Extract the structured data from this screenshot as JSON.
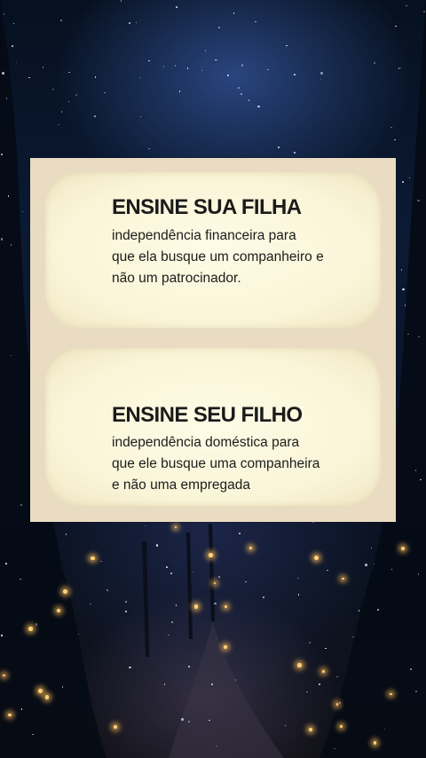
{
  "card_top": {
    "title": "ENSINE SUA FILHA",
    "lines": [
      "independência financeira para",
      "que ela busque um companheiro e",
      "não um patrocinador."
    ]
  },
  "card_bottom": {
    "title": "ENSINE SEU FILHO",
    "lines": [
      "independência doméstica para",
      "que ele busque uma companheira",
      "e não uma empregada"
    ]
  },
  "colors": {
    "card": "#faf5d8",
    "frame": "#e9dcc2",
    "text": "#1b1b1b",
    "sky": "#0b1a33"
  }
}
